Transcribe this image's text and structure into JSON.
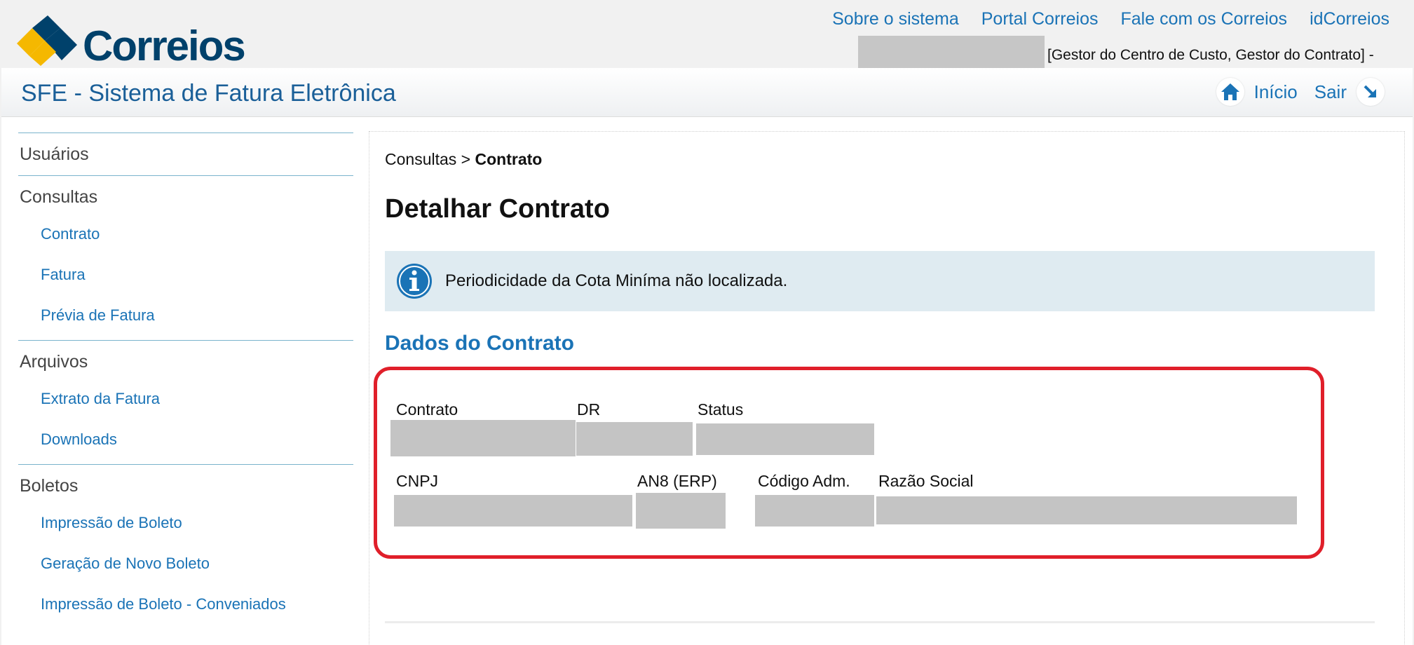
{
  "header": {
    "logo_text": "Correios",
    "links": [
      "Sobre o sistema",
      "Portal Correios",
      "Fale com os Correios",
      "idCorreios"
    ],
    "user_roles": "[Gestor do Centro de Custo, Gestor do Contrato] -"
  },
  "titlebar": {
    "system_title": "SFE - Sistema de Fatura Eletrônica",
    "home_label": "Início",
    "exit_label": "Sair"
  },
  "sidebar": {
    "groups": [
      {
        "label": "Usuários",
        "items": []
      },
      {
        "label": "Consultas",
        "items": [
          "Contrato",
          "Fatura",
          "Prévia de Fatura"
        ]
      },
      {
        "label": "Arquivos",
        "items": [
          "Extrato da Fatura",
          "Downloads"
        ]
      },
      {
        "label": "Boletos",
        "items": [
          "Impressão de Boleto",
          "Geração de Novo Boleto",
          "Impressão de Boleto - Conveniados"
        ]
      }
    ]
  },
  "main": {
    "breadcrumb_parent": "Consultas",
    "breadcrumb_sep": " > ",
    "breadcrumb_current": "Contrato",
    "page_title": "Detalhar Contrato",
    "alert_text": "Periodicidade da Cota Miníma não localizada.",
    "section_title": "Dados do Contrato",
    "fields": {
      "contrato": "Contrato",
      "dr": "DR",
      "status": "Status",
      "cnpj": "CNPJ",
      "an8": "AN8 (ERP)",
      "codigo_adm": "Código Adm.",
      "razao_social": "Razão Social"
    }
  },
  "colors": {
    "brand_blue": "#00416b",
    "link_blue": "#1a73b6",
    "logo_yellow": "#f5b800",
    "highlight_red": "#e01f2a",
    "alert_bg": "#dfebf1"
  }
}
